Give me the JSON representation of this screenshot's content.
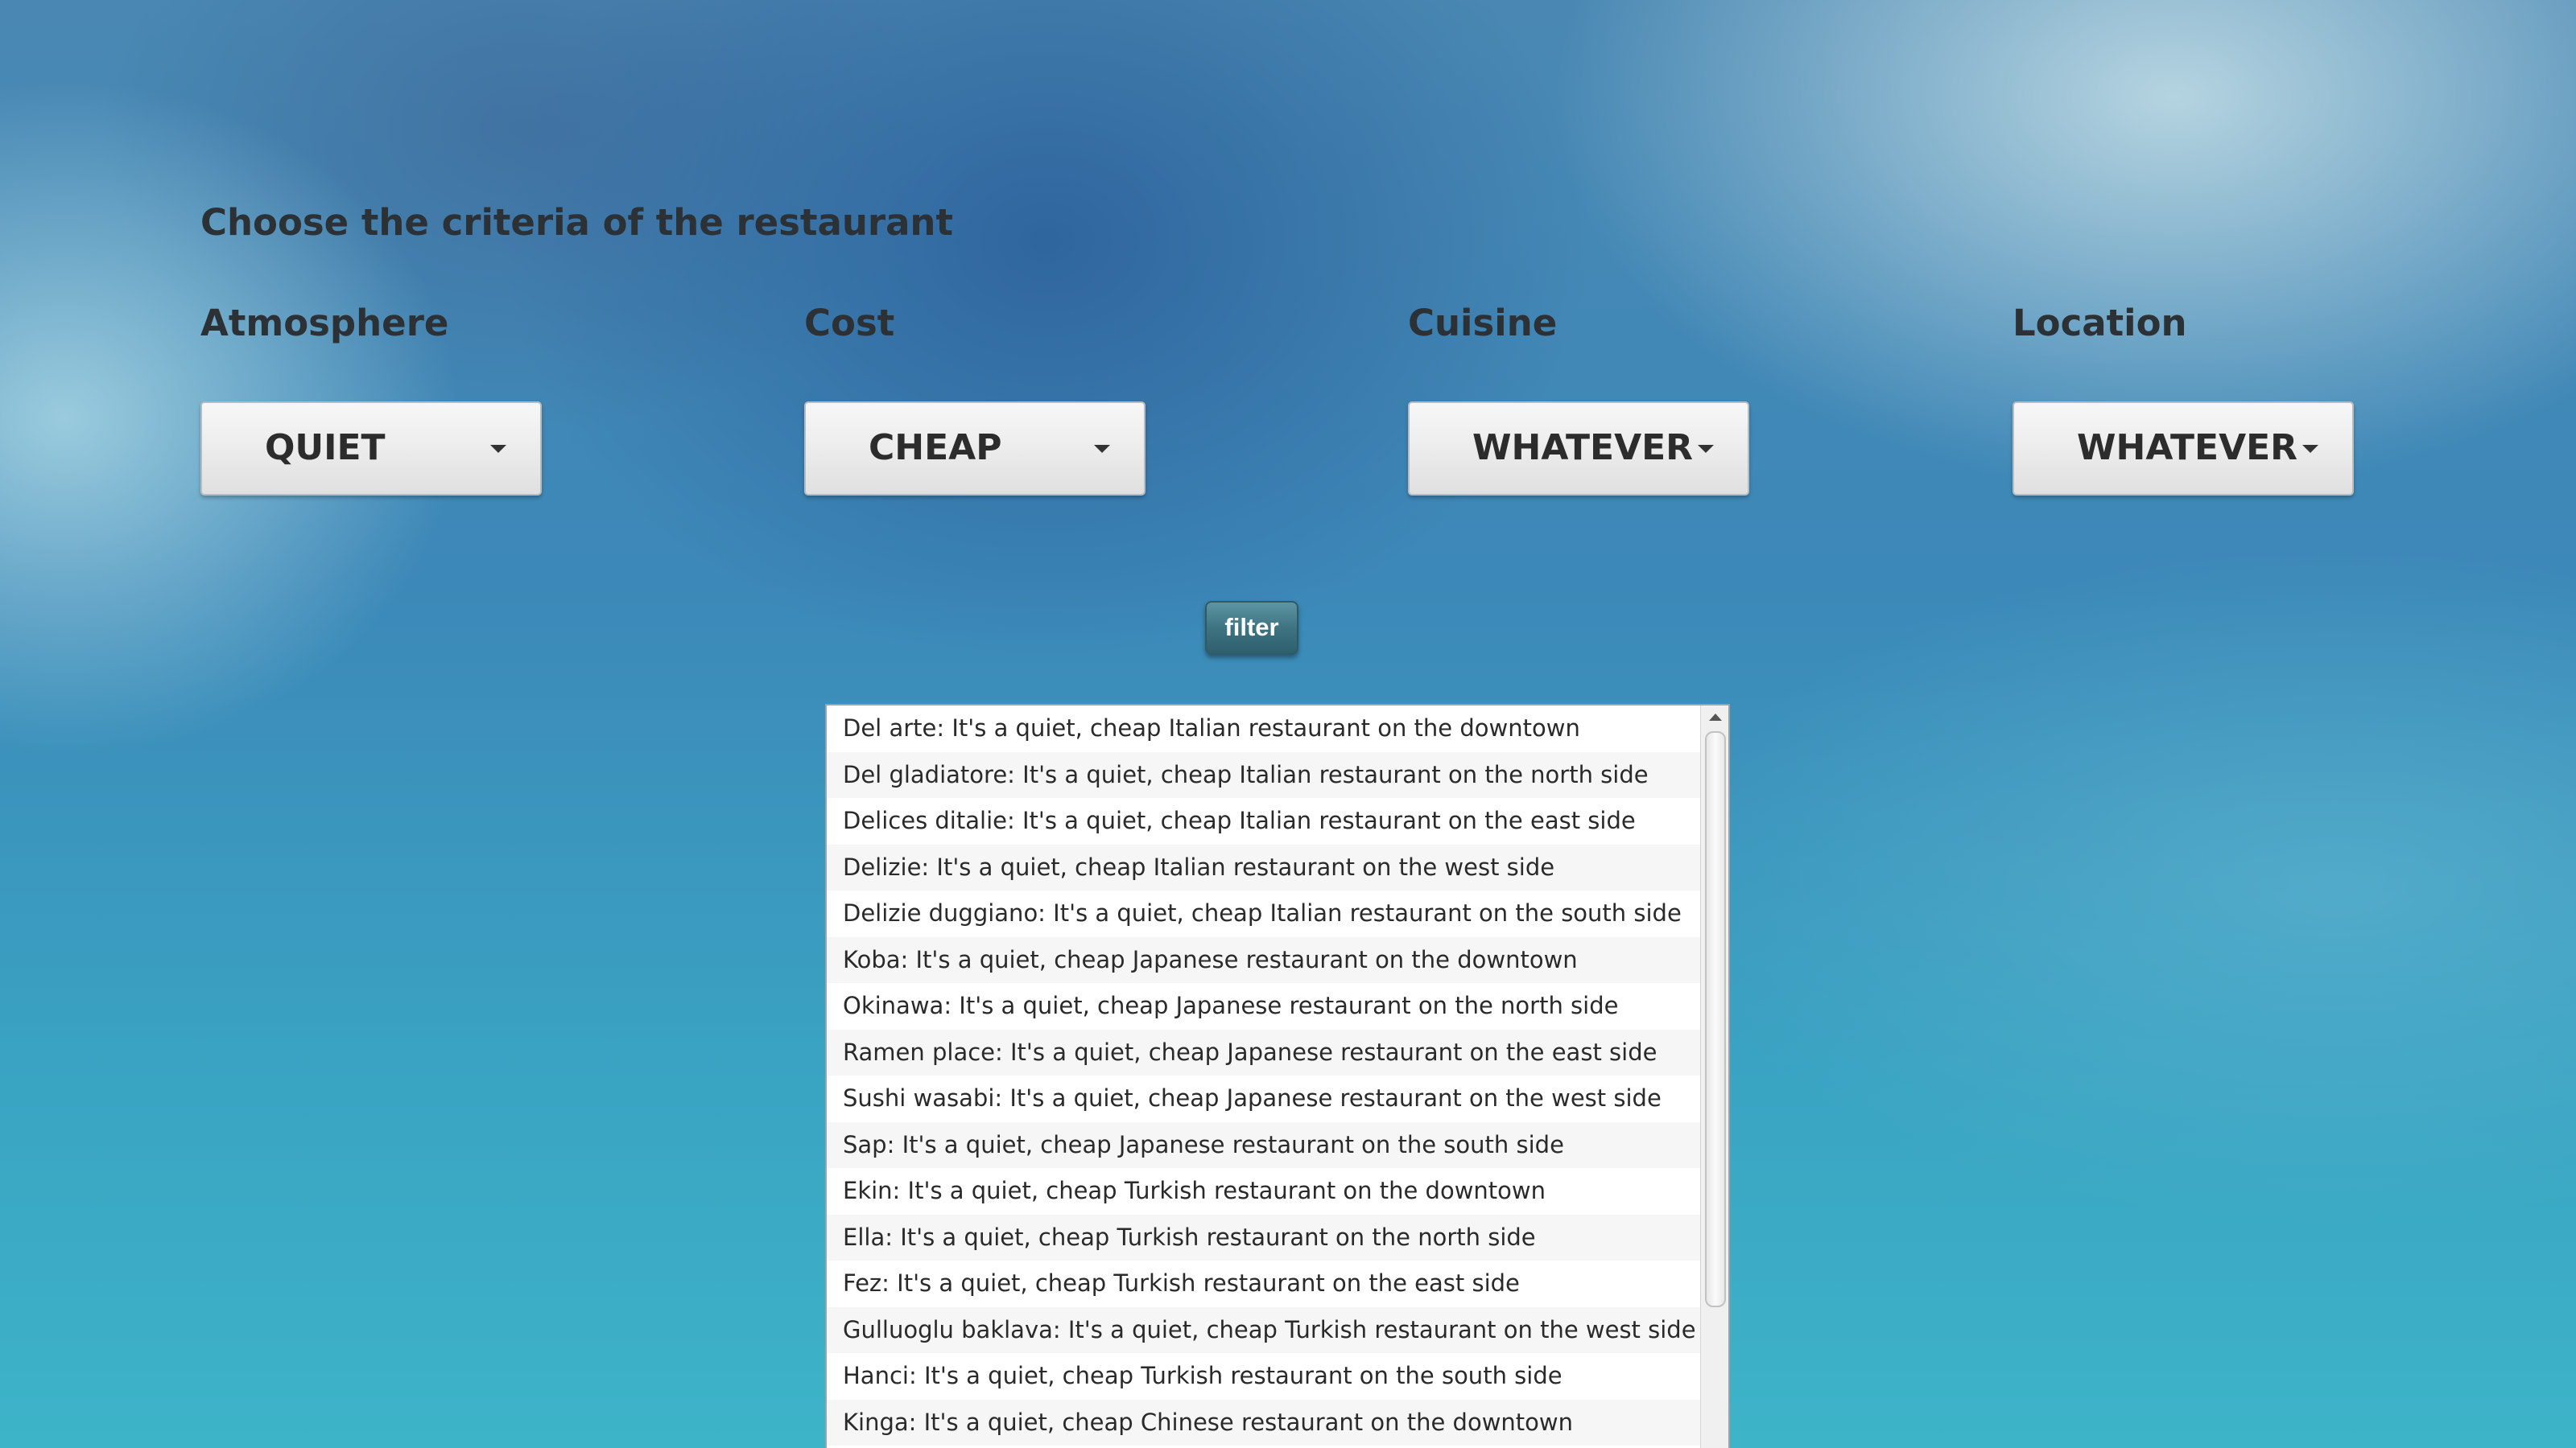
{
  "page": {
    "title": "Choose the criteria of the restaurant"
  },
  "criteria": {
    "atmosphere": {
      "label": "Atmosphere",
      "value": "QUIET"
    },
    "cost": {
      "label": "Cost",
      "value": "CHEAP"
    },
    "cuisine": {
      "label": "Cuisine",
      "value": "WHATEVER"
    },
    "location": {
      "label": "Location",
      "value": "WHATEVER"
    }
  },
  "filter_button": {
    "label": "filter"
  },
  "results": {
    "items": [
      "Del arte: It's a quiet, cheap Italian restaurant on the downtown",
      "Del gladiatore: It's a quiet, cheap Italian restaurant on the north side",
      "Delices ditalie: It's a quiet, cheap Italian restaurant on the east side",
      "Delizie: It's a quiet, cheap Italian restaurant on the west side",
      "Delizie duggiano: It's a quiet, cheap Italian restaurant on the south side",
      "Koba: It's a quiet, cheap Japanese restaurant on the downtown",
      "Okinawa: It's a quiet, cheap Japanese restaurant on the north side",
      "Ramen place: It's a quiet, cheap Japanese restaurant on the east side",
      "Sushi wasabi: It's a quiet, cheap Japanese restaurant on the west side",
      "Sap: It's a quiet, cheap Japanese restaurant on the south side",
      "Ekin: It's a quiet, cheap Turkish restaurant on the downtown",
      "Ella: It's a quiet, cheap Turkish restaurant on the north side",
      "Fez: It's a quiet, cheap Turkish restaurant on the east side",
      "Gulluoglu baklava: It's a quiet, cheap Turkish restaurant on the west side",
      "Hanci: It's a quiet, cheap Turkish restaurant on the south side",
      "Kinga: It's a quiet, cheap Chinese restaurant on the downtown"
    ]
  }
}
